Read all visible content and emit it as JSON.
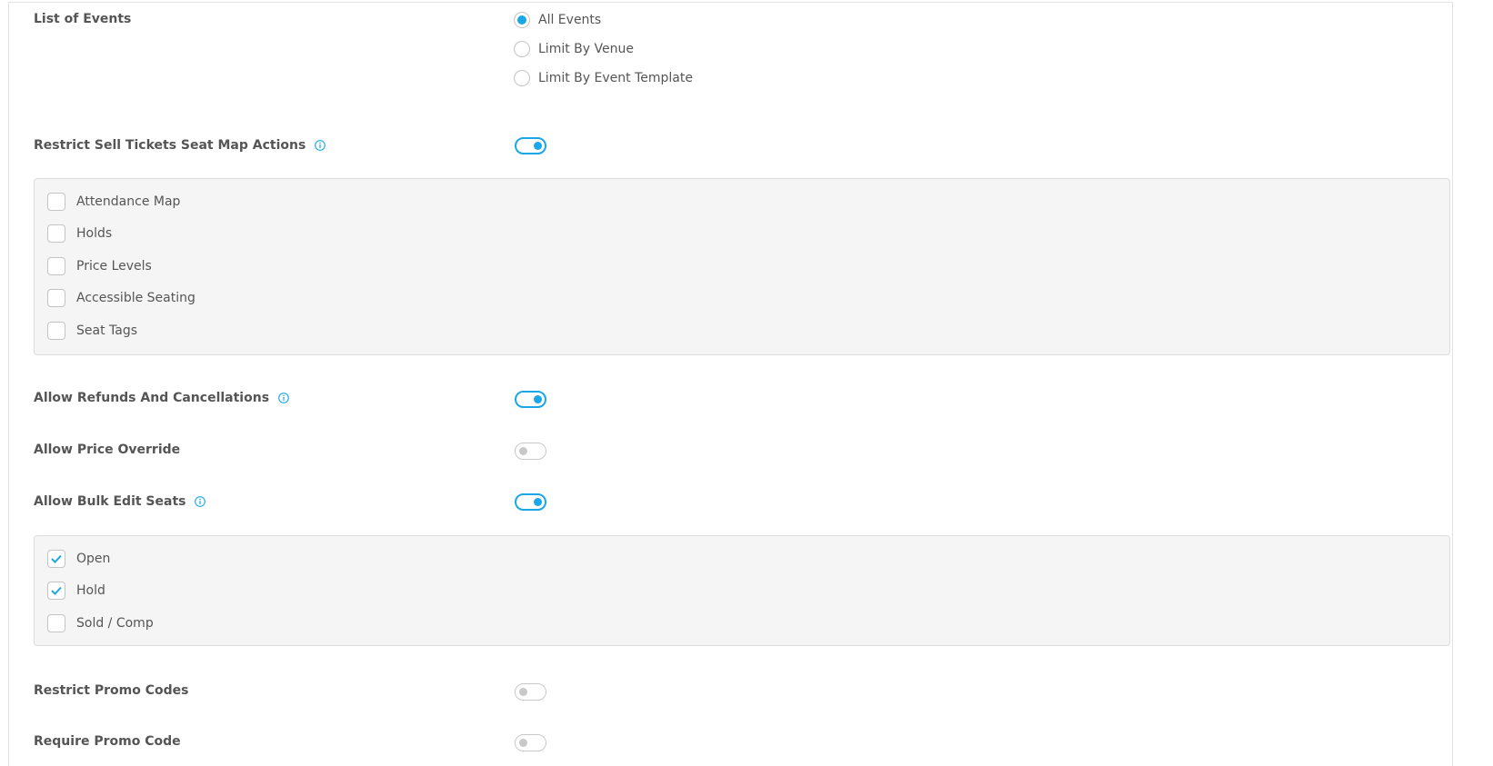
{
  "colors": {
    "accent": "#1aa7e8",
    "off": "#c8c8c8",
    "label": "#555555",
    "box_bg": "#f5f5f5"
  },
  "list_of_events": {
    "label": "List of Events",
    "options": [
      {
        "label": "All Events",
        "selected": true
      },
      {
        "label": "Limit By Venue",
        "selected": false
      },
      {
        "label": "Limit By Event Template",
        "selected": false
      }
    ]
  },
  "restrict_seat_map": {
    "label": "Restrict Sell Tickets Seat Map Actions",
    "enabled": true,
    "options": [
      {
        "label": "Attendance Map",
        "checked": false
      },
      {
        "label": "Holds",
        "checked": false
      },
      {
        "label": "Price Levels",
        "checked": false
      },
      {
        "label": "Accessible Seating",
        "checked": false
      },
      {
        "label": "Seat Tags",
        "checked": false
      }
    ]
  },
  "allow_refunds": {
    "label": "Allow Refunds And Cancellations",
    "enabled": true
  },
  "allow_price_override": {
    "label": "Allow Price Override",
    "enabled": false
  },
  "allow_bulk_edit": {
    "label": "Allow Bulk Edit Seats",
    "enabled": true,
    "options": [
      {
        "label": "Open",
        "checked": true
      },
      {
        "label": "Hold",
        "checked": true
      },
      {
        "label": "Sold / Comp",
        "checked": false
      }
    ]
  },
  "restrict_promo": {
    "label": "Restrict Promo Codes",
    "enabled": false
  },
  "require_promo": {
    "label": "Require Promo Code",
    "enabled": false
  }
}
